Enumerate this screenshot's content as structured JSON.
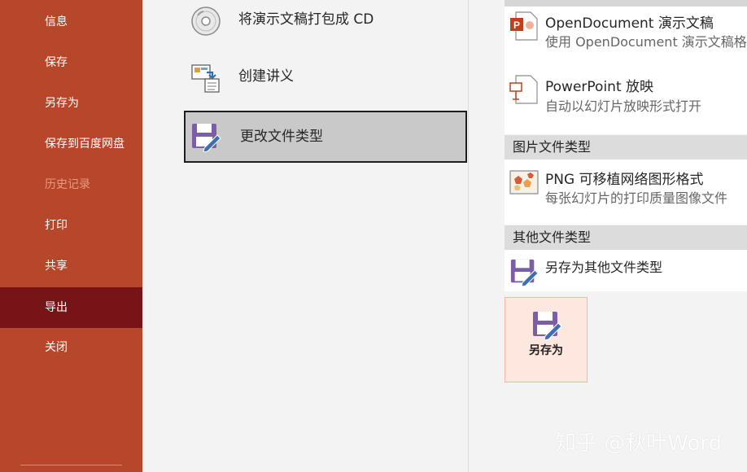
{
  "sidebar": {
    "items": [
      {
        "label": "信息"
      },
      {
        "label": "保存"
      },
      {
        "label": "另存为"
      },
      {
        "label": "保存到百度网盘"
      },
      {
        "label": "历史记录",
        "state": "disabled"
      },
      {
        "label": "打印"
      },
      {
        "label": "共享"
      },
      {
        "label": "导出",
        "state": "selected"
      },
      {
        "label": "关闭"
      }
    ]
  },
  "export_options": [
    {
      "label": "将演示文稿打包成 CD",
      "icon": "cd-icon"
    },
    {
      "label": "创建讲义",
      "icon": "handout-icon"
    },
    {
      "label": "更改文件类型",
      "icon": "save-pencil-icon",
      "state": "selected"
    }
  ],
  "file_types": {
    "presentation_items": [
      {
        "title": "OpenDocument 演示文稿",
        "desc": "使用 OpenDocument 演示文稿格",
        "icon": "opendocument-icon"
      },
      {
        "title": "PowerPoint 放映",
        "desc": "自动以幻灯片放映形式打开",
        "icon": "slideshow-icon"
      }
    ],
    "image_header": "图片文件类型",
    "image_items": [
      {
        "title": "PNG 可移植网络图形格式",
        "desc": "每张幻灯片的打印质量图像文件",
        "icon": "png-image-icon"
      }
    ],
    "other_header": "其他文件类型",
    "other_items": [
      {
        "title": "另存为其他文件类型",
        "icon": "save-pencil-icon"
      }
    ]
  },
  "saveas_button": {
    "label": "另存为",
    "icon": "save-pencil-icon"
  },
  "watermark": "知乎 @秋叶Word",
  "colors": {
    "sidebar_bg": "#b7472a",
    "sidebar_active": "#771418",
    "sidebar_disabled_text": "#e89a84",
    "selected_option_bg": "#c9c9c9",
    "section_header_bg": "#dcdcdc",
    "saveas_bg": "#fde7df"
  }
}
